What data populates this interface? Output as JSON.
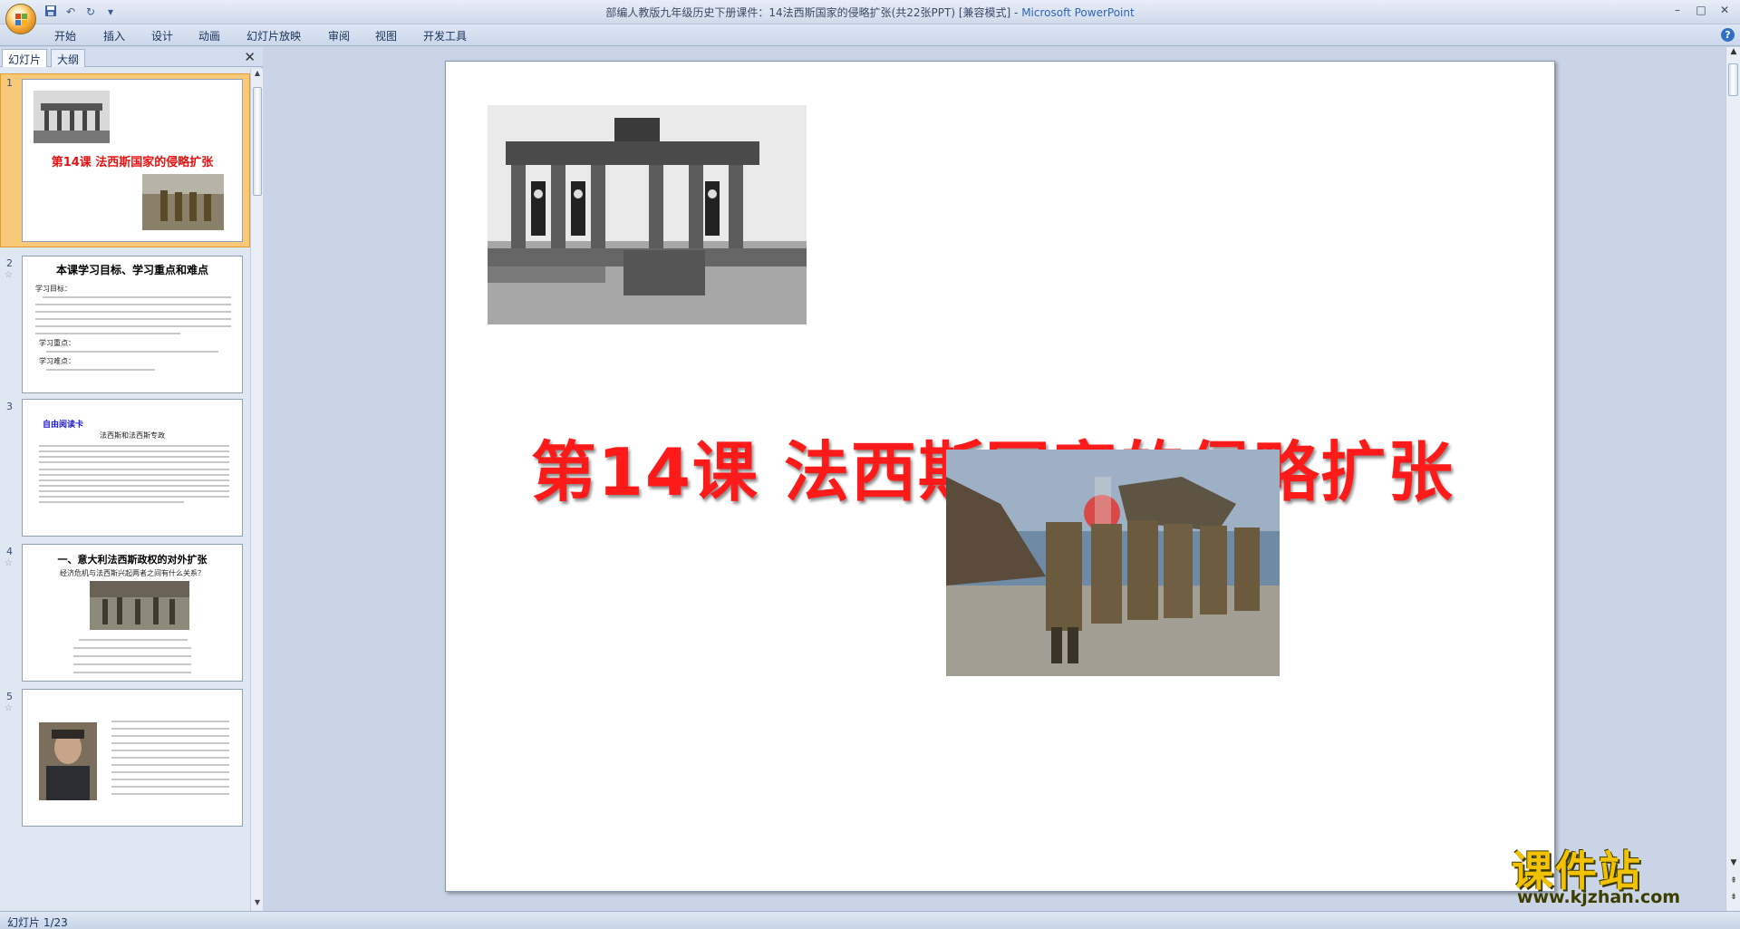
{
  "window": {
    "title": "部编人教版九年级历史下册课件：14法西斯国家的侵略扩张(共22张PPT) [兼容模式]",
    "app_name": "Microsoft PowerPoint",
    "controls": [
      "–",
      "□",
      "✕"
    ]
  },
  "ribbon": {
    "tabs": [
      "开始",
      "插入",
      "设计",
      "动画",
      "幻灯片放映",
      "审阅",
      "视图",
      "开发工具"
    ],
    "help": "?"
  },
  "left_panel": {
    "tabs": [
      "幻灯片",
      "大纲"
    ],
    "close": "✕",
    "slides": [
      {
        "num": "1",
        "title": "第14课  法西斯国家的侵略扩张"
      },
      {
        "num": "2",
        "title": "本课学习目标、学习重点和难点",
        "lines": [
          "学习目标：",
          "学习重点：",
          "学习难点："
        ]
      },
      {
        "num": "3",
        "title": "自由阅读卡",
        "subtitle": "法西斯和法西斯专政"
      },
      {
        "num": "4",
        "title": "一、意大利法西斯政权的对外扩张",
        "question": "经济危机与法西斯兴起两者之间有什么关系？"
      },
      {
        "num": "5",
        "title": ""
      }
    ]
  },
  "slide": {
    "title": "第14课  法西斯国家的侵略扩张",
    "images": [
      "brandenburg-gate-parade-photo",
      "japanese-soldiers-march-photo"
    ]
  },
  "status_bar": {
    "slide_info": "幻灯片 1/23"
  },
  "watermark": {
    "text": "课件站",
    "url": "www.kjzhan.com"
  },
  "colors": {
    "title_red": "#ff1a1a",
    "ribbon_blue": "#c9d5e6",
    "selected_thumb": "#f7c978"
  }
}
